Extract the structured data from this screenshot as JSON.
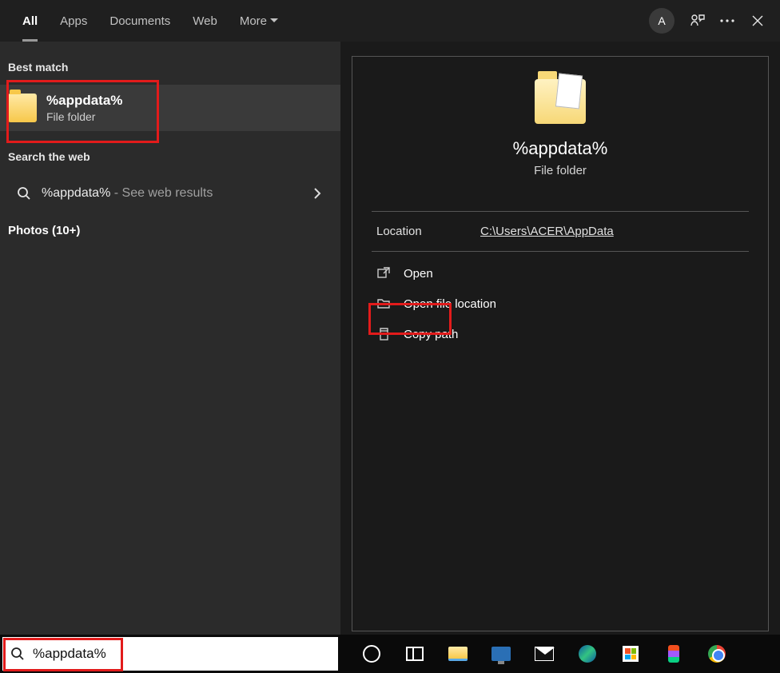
{
  "header": {
    "tabs": {
      "all": "All",
      "apps": "Apps",
      "documents": "Documents",
      "web": "Web",
      "more": "More"
    },
    "avatar_letter": "A"
  },
  "left": {
    "best_match_hdr": "Best match",
    "result": {
      "title": "%appdata%",
      "subtitle": "File folder"
    },
    "search_web_hdr": "Search the web",
    "web_result": {
      "term": "%appdata%",
      "suffix": " - See web results"
    },
    "photos_hdr": "Photos (10+)"
  },
  "preview": {
    "title": "%appdata%",
    "subtitle": "File folder",
    "location_label": "Location",
    "location_value": "C:\\Users\\ACER\\AppData",
    "actions": {
      "open": "Open",
      "open_loc": "Open file location",
      "copy_path": "Copy path"
    }
  },
  "search": {
    "value": "%appdata%"
  }
}
